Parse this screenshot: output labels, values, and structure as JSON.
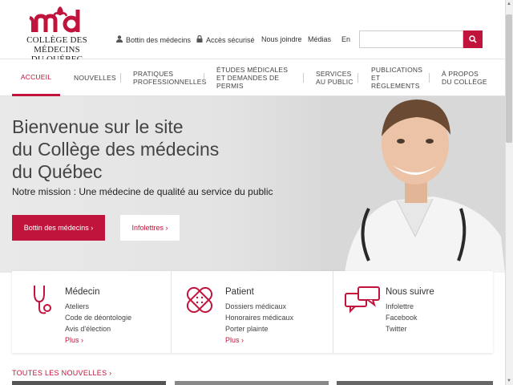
{
  "logo": {
    "line1": "COLLÈGE DES MÉDECINS",
    "line2": "DU QUÉBEC"
  },
  "util_nav": {
    "bottin": "Bottin des médecins",
    "acces": "Accès sécurisé",
    "joindre": "Nous joindre",
    "medias": "Médias",
    "lang": "En"
  },
  "search": {
    "placeholder": ""
  },
  "main_nav": [
    {
      "label": "ACCUEIL"
    },
    {
      "label": "NOUVELLES"
    },
    {
      "label_l1": "PRATIQUES",
      "label_l2": "PROFESSIONNELLES"
    },
    {
      "label_l1": "ÉTUDES MÉDICALES",
      "label_l2": "ET DEMANDES DE PERMIS"
    },
    {
      "label_l1": "SERVICES",
      "label_l2": "AU PUBLIC"
    },
    {
      "label_l1": "PUBLICATIONS",
      "label_l2": "ET RÈGLEMENTS"
    },
    {
      "label_l1": "À PROPOS",
      "label_l2": "DU COLLÈGE"
    }
  ],
  "hero": {
    "title_l1": "Bienvenue sur le site",
    "title_l2": "du Collège des médecins",
    "title_l3": "du Québec",
    "mission": "Notre mission : Une médecine de qualité au service du public",
    "btn_bottin": "Bottin des médecins ›",
    "btn_infolettres": "Infolettres ›"
  },
  "cards": [
    {
      "title": "Médecin",
      "links": [
        "Ateliers",
        "Code de déontologie",
        "Avis d'élection"
      ],
      "more": "Plus ›"
    },
    {
      "title": "Patient",
      "links": [
        "Dossiers médicaux",
        "Honoraires médicaux",
        "Porter plainte"
      ],
      "more": "Plus ›"
    },
    {
      "title": "Nous suivre",
      "links": [
        "Infolettre",
        "Facebook",
        "Twitter"
      ]
    }
  ],
  "news": {
    "title": "TOUTES LES NOUVELLES ›"
  },
  "colors": {
    "brand": "#c0143c"
  },
  "icons": [
    "user-icon",
    "lock-icon",
    "search-icon",
    "stethoscope-icon",
    "bandage-icon",
    "chat-bubbles-icon",
    "fleur-de-lis-logo"
  ]
}
